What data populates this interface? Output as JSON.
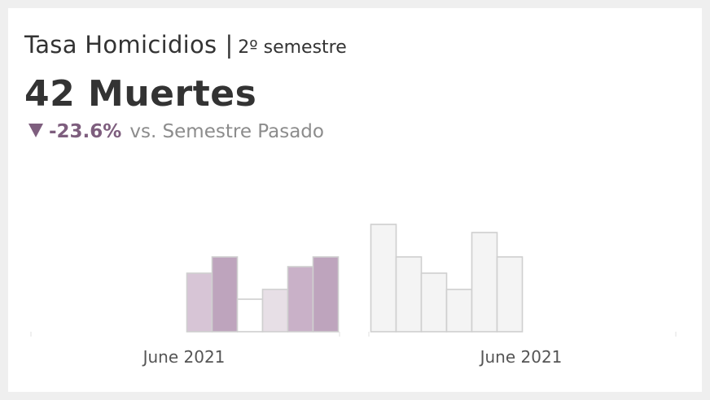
{
  "header": {
    "title": "Tasa Homicidios",
    "separator": "|",
    "subtitle": "2º semestre",
    "kpi": "42 Muertes",
    "delta_value": "-23.6%",
    "delta_text": "vs. Semestre Pasado",
    "delta_icon": "triangle-down-icon",
    "delta_color": "#7e5e7e"
  },
  "chart_data": {
    "type": "bar",
    "xlabel": "",
    "ylabel": "",
    "grid": false,
    "legend": "none",
    "x_tick_labels": [
      "June 2021",
      "June 2021"
    ],
    "ylim": [
      0,
      10
    ],
    "groups": [
      {
        "label": "June 2021",
        "values": [
          3.6,
          4.6,
          2.0,
          2.6,
          4.0,
          4.6
        ],
        "colors": [
          "#d7c5d6",
          "#bea4bd",
          "#ffffff",
          "#e7dfe6",
          "#c9b1c8",
          "#bea4bd"
        ]
      },
      {
        "label": "June 2021",
        "values": [
          6.6,
          4.6,
          3.6,
          2.6,
          6.1,
          4.6
        ],
        "colors": [
          "#f4f4f4",
          "#f4f4f4",
          "#f4f4f4",
          "#f4f4f4",
          "#f4f4f4",
          "#f4f4f4"
        ]
      }
    ],
    "bar_stroke": "#cfcfcf"
  }
}
